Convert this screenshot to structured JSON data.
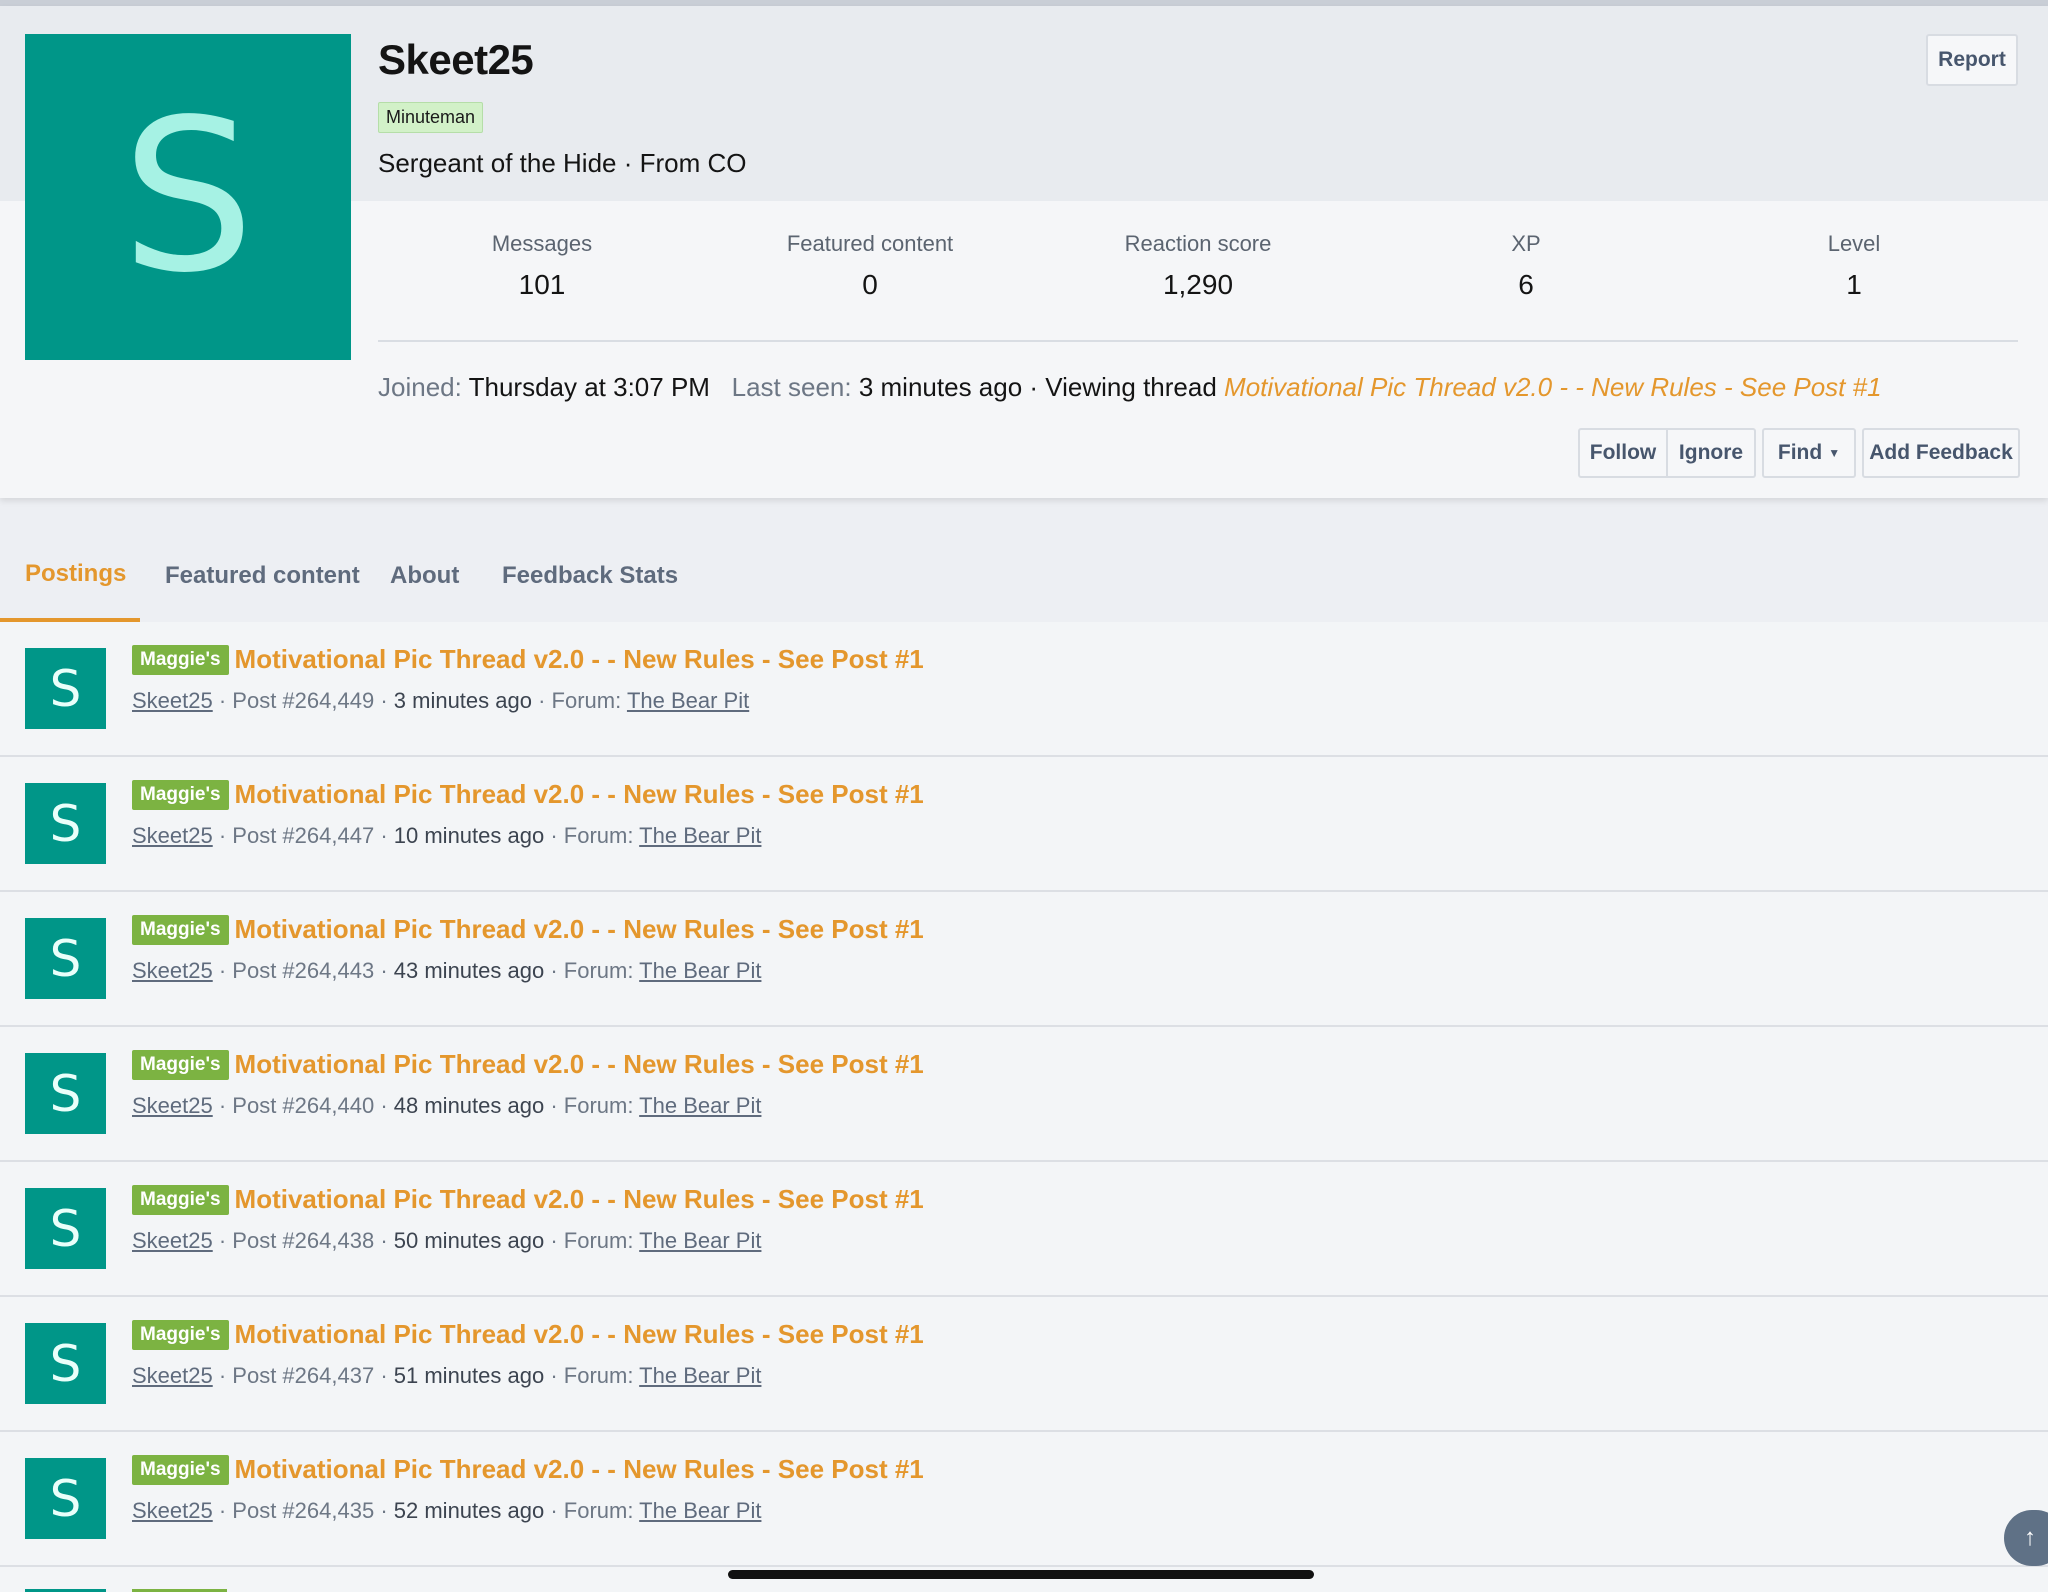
{
  "profile": {
    "avatar_letter": "S",
    "username": "Skeet25",
    "rank_badge": "Minuteman",
    "user_title": "Sergeant of the Hide · From CO",
    "report_label": "Report",
    "stats": [
      {
        "label": "Messages",
        "value": "101"
      },
      {
        "label": "Featured content",
        "value": "0"
      },
      {
        "label": "Reaction score",
        "value": "1,290"
      },
      {
        "label": "XP",
        "value": "6"
      },
      {
        "label": "Level",
        "value": "1"
      }
    ],
    "joined_label": "Joined:",
    "joined_value": "Thursday at 3:07 PM",
    "last_seen_label": "Last seen:",
    "last_seen_value": "3 minutes ago · Viewing thread",
    "last_seen_thread": "Motivational Pic Thread v2.0 - - New Rules - See Post #1",
    "actions": {
      "follow": "Follow",
      "ignore": "Ignore",
      "find": "Find",
      "add_feedback": "Add Feedback"
    }
  },
  "tabs": [
    {
      "label": "Postings",
      "active": true
    },
    {
      "label": "Featured content",
      "active": false
    },
    {
      "label": "About",
      "active": false
    },
    {
      "label": "Feedback Stats",
      "active": false
    }
  ],
  "posts": [
    {
      "avatar_letter": "S",
      "prefix": "Maggie's",
      "title": "Motivational Pic Thread v2.0 - - New Rules - See Post #1",
      "author": "Skeet25",
      "post_no": "Post #264,449",
      "time": "3 minutes ago",
      "forum_label": "Forum:",
      "forum": "The Bear Pit"
    },
    {
      "avatar_letter": "S",
      "prefix": "Maggie's",
      "title": "Motivational Pic Thread v2.0 - - New Rules - See Post #1",
      "author": "Skeet25",
      "post_no": "Post #264,447",
      "time": "10 minutes ago",
      "forum_label": "Forum:",
      "forum": "The Bear Pit"
    },
    {
      "avatar_letter": "S",
      "prefix": "Maggie's",
      "title": "Motivational Pic Thread v2.0 - - New Rules - See Post #1",
      "author": "Skeet25",
      "post_no": "Post #264,443",
      "time": "43 minutes ago",
      "forum_label": "Forum:",
      "forum": "The Bear Pit"
    },
    {
      "avatar_letter": "S",
      "prefix": "Maggie's",
      "title": "Motivational Pic Thread v2.0 - - New Rules - See Post #1",
      "author": "Skeet25",
      "post_no": "Post #264,440",
      "time": "48 minutes ago",
      "forum_label": "Forum:",
      "forum": "The Bear Pit"
    },
    {
      "avatar_letter": "S",
      "prefix": "Maggie's",
      "title": "Motivational Pic Thread v2.0 - - New Rules - See Post #1",
      "author": "Skeet25",
      "post_no": "Post #264,438",
      "time": "50 minutes ago",
      "forum_label": "Forum:",
      "forum": "The Bear Pit"
    },
    {
      "avatar_letter": "S",
      "prefix": "Maggie's",
      "title": "Motivational Pic Thread v2.0 - - New Rules - See Post #1",
      "author": "Skeet25",
      "post_no": "Post #264,437",
      "time": "51 minutes ago",
      "forum_label": "Forum:",
      "forum": "The Bear Pit"
    },
    {
      "avatar_letter": "S",
      "prefix": "Maggie's",
      "title": "Motivational Pic Thread v2.0 - - New Rules - See Post #1",
      "author": "Skeet25",
      "post_no": "Post #264,435",
      "time": "52 minutes ago",
      "forum_label": "Forum:",
      "forum": "The Bear Pit"
    }
  ],
  "colors": {
    "accent": "#e4972d",
    "avatar_bg": "#009688",
    "prefix_bg": "#7cb342",
    "rank_bg": "#d2f1c8"
  },
  "icons": {
    "scroll_top": "arrow-up-icon",
    "find_caret": "caret-down-icon"
  }
}
